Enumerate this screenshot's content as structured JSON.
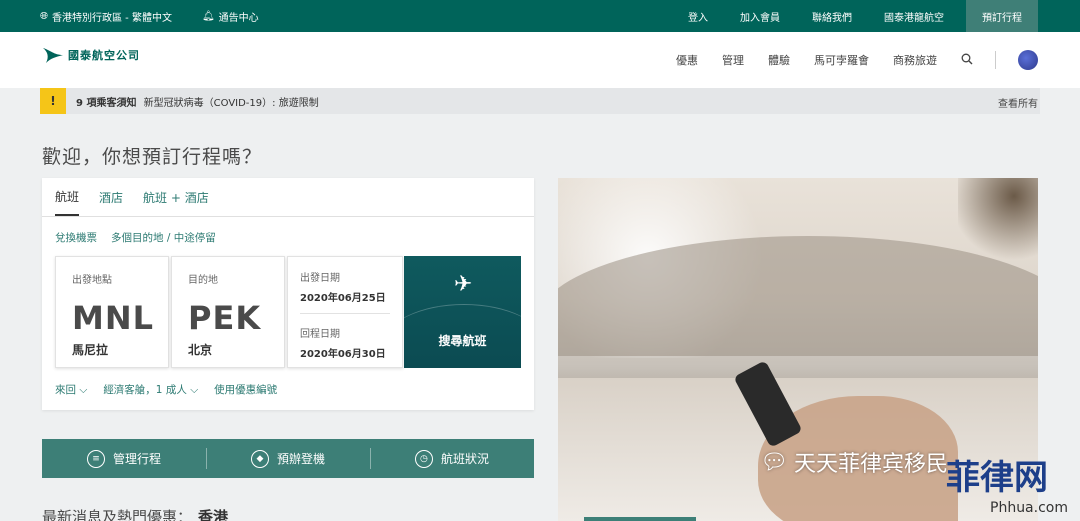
{
  "topbar": {
    "region": "香港特別行政區 - 繁體中文",
    "alerts": "通告中心",
    "links": [
      "登入",
      "加入會員",
      "聯絡我們",
      "國泰港龍航空"
    ],
    "cta": "預訂行程"
  },
  "header": {
    "logo_text": "國泰航空公司",
    "nav": [
      "優惠",
      "管理",
      "體驗",
      "馬可孛羅會",
      "商務旅遊"
    ]
  },
  "notice": {
    "count": "9 項乘客須知",
    "text": "新型冠狀病毒（COVID-19）: 旅遊限制",
    "view_all": "查看所有"
  },
  "welcome": "歡迎，你想預訂行程嗎？",
  "booking": {
    "tabs": [
      "航班",
      "酒店",
      "航班 + 酒店"
    ],
    "sublinks": [
      "兌換機票",
      "多個目的地 / 中途停留"
    ],
    "origin": {
      "label": "出發地點",
      "code": "MNL",
      "city": "馬尼拉"
    },
    "destination": {
      "label": "目的地",
      "code": "PEK",
      "city": "北京"
    },
    "depart": {
      "label": "出發日期",
      "value": "2020年06月25日"
    },
    "return": {
      "label": "回程日期",
      "value": "2020年06月30日"
    },
    "search_label": "搜尋航班",
    "options": [
      "來回",
      "經濟客艙，1 成人",
      "使用優惠編號"
    ]
  },
  "actions": [
    "管理行程",
    "預辦登機",
    "航班狀況"
  ],
  "news": {
    "label": "最新消息及熱門優惠：",
    "region": "香港"
  },
  "watermark": {
    "text": "天天菲律宾移民",
    "mark": "菲律网",
    "site": "Phhua.com"
  }
}
